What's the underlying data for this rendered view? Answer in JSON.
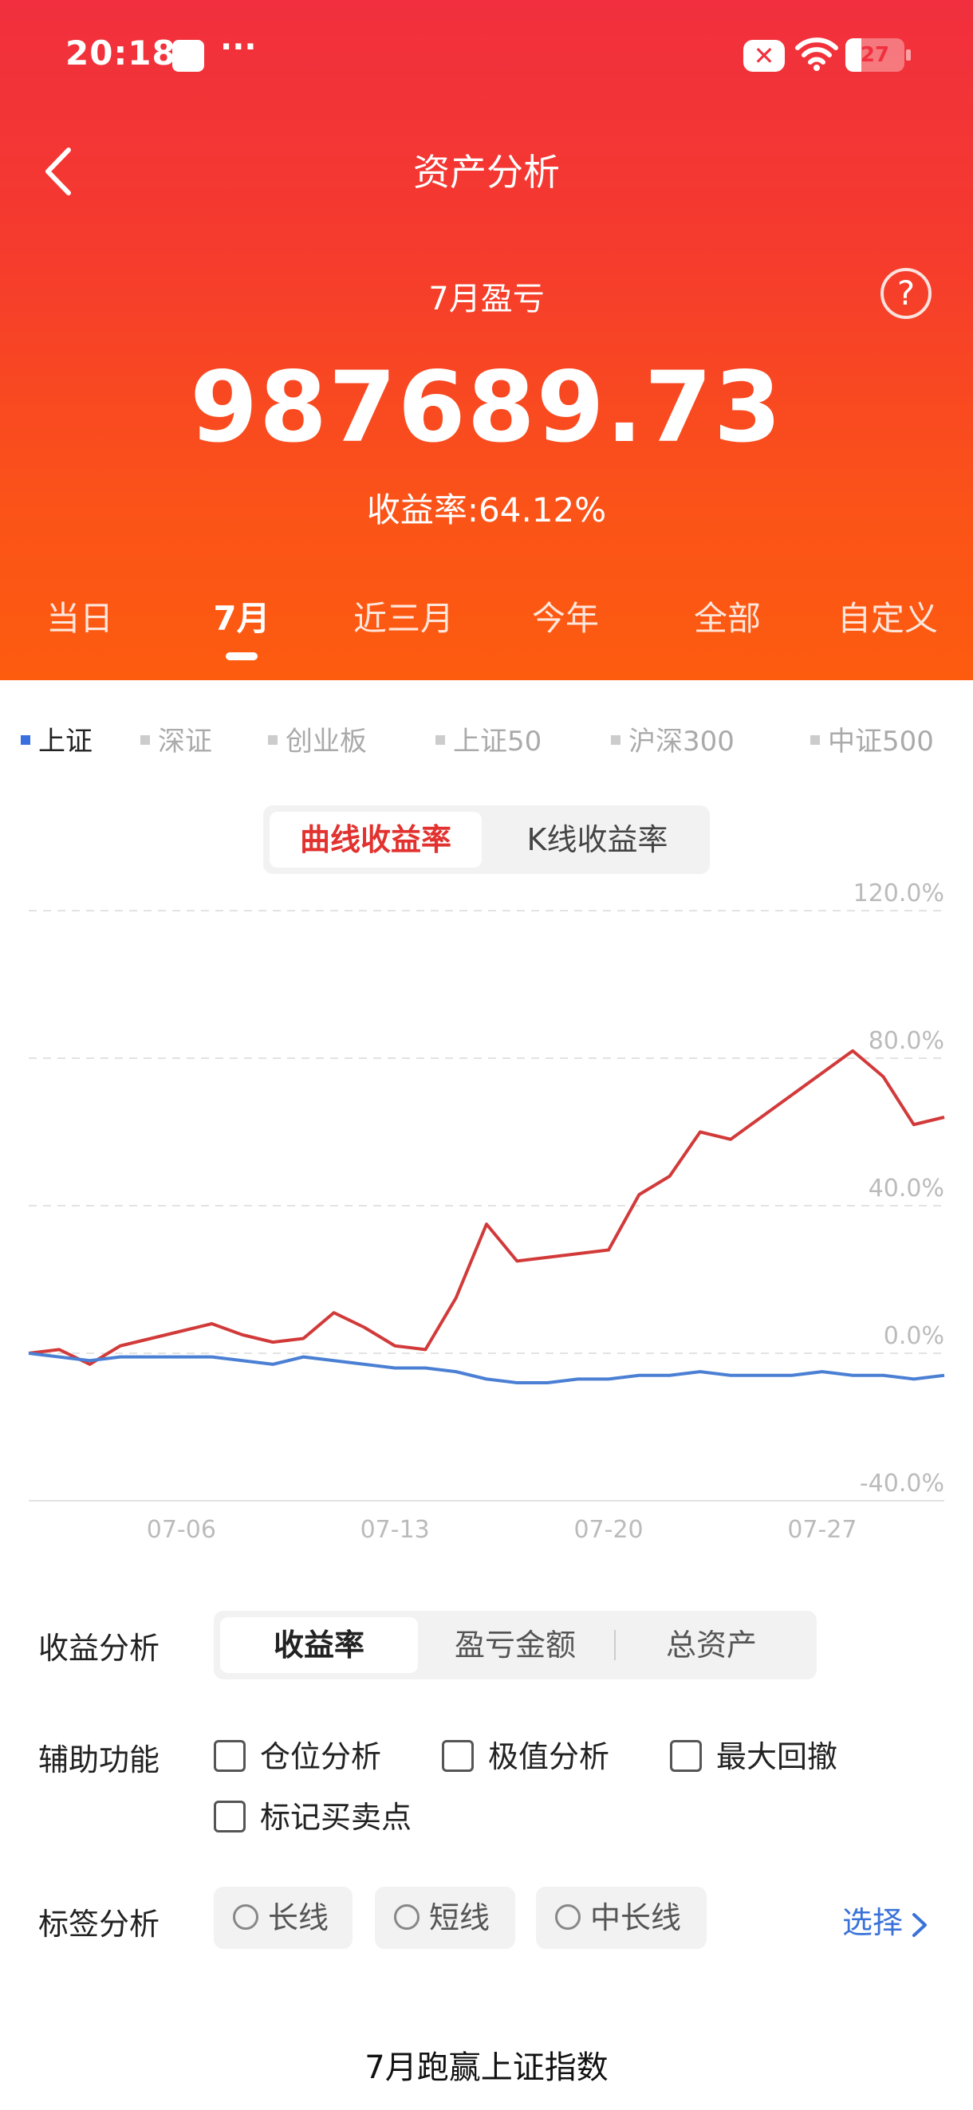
{
  "status_bar": {
    "time": "20:18",
    "battery": "27",
    "battery_level": 0.27
  },
  "header": {
    "title": "资产分析",
    "period_label": "7月盈亏",
    "amount": "987689.73",
    "rate_text": "收益率:64.12%",
    "tabs": [
      "当日",
      "7月",
      "近三月",
      "今年",
      "全部",
      "自定义"
    ],
    "active_tab": 1
  },
  "indices": [
    "上证",
    "深证",
    "创业板",
    "上证50",
    "沪深300",
    "中证500"
  ],
  "active_index": 0,
  "chart_mode": {
    "options": [
      "曲线收益率",
      "K线收益率"
    ],
    "active": 0
  },
  "chart_data": {
    "type": "line",
    "y_ticks": [
      "120.0%",
      "80.0%",
      "40.0%",
      "0.0%",
      "-40.0%"
    ],
    "x_ticks": [
      "07-06",
      "07-13",
      "07-20",
      "07-27"
    ],
    "ylim": [
      -40,
      120
    ],
    "xlim": [
      1,
      31
    ],
    "grid": true,
    "series": [
      {
        "color": "#d23a3a",
        "x": [
          1,
          2,
          3,
          4,
          5,
          6,
          7,
          8,
          9,
          10,
          11,
          12,
          13,
          14,
          15,
          16,
          17,
          18,
          19,
          20,
          21,
          22,
          23,
          24,
          25,
          26,
          27,
          28,
          29,
          30,
          31
        ],
        "y": [
          0,
          1,
          -3,
          2,
          4,
          6,
          8,
          5,
          3,
          4,
          11,
          7,
          2,
          1,
          15,
          35,
          25,
          26,
          27,
          28,
          43,
          48,
          60,
          58,
          64,
          70,
          76,
          82,
          75,
          62,
          64
        ]
      },
      {
        "color": "#4a7fd4",
        "x": [
          1,
          2,
          3,
          4,
          5,
          6,
          7,
          8,
          9,
          10,
          11,
          12,
          13,
          14,
          15,
          16,
          17,
          18,
          19,
          20,
          21,
          22,
          23,
          24,
          25,
          26,
          27,
          28,
          29,
          30,
          31
        ],
        "y": [
          0,
          -1,
          -2,
          -1,
          -1,
          -1,
          -1,
          -2,
          -3,
          -1,
          -2,
          -3,
          -4,
          -4,
          -5,
          -7,
          -8,
          -8,
          -7,
          -7,
          -6,
          -6,
          -5,
          -6,
          -6,
          -6,
          -5,
          -6,
          -6,
          -7,
          -6
        ]
      }
    ]
  },
  "analysis": {
    "label": "收益分析",
    "options": [
      "收益率",
      "盈亏金额",
      "总资产"
    ],
    "active": 0
  },
  "aux": {
    "label": "辅助功能",
    "options": [
      "仓位分析",
      "极值分析",
      "最大回撤",
      "标记买卖点"
    ]
  },
  "tags": {
    "label": "标签分析",
    "options": [
      "长线",
      "短线",
      "中长线"
    ],
    "choose": "选择"
  },
  "footer": "7月跑赢上证指数"
}
